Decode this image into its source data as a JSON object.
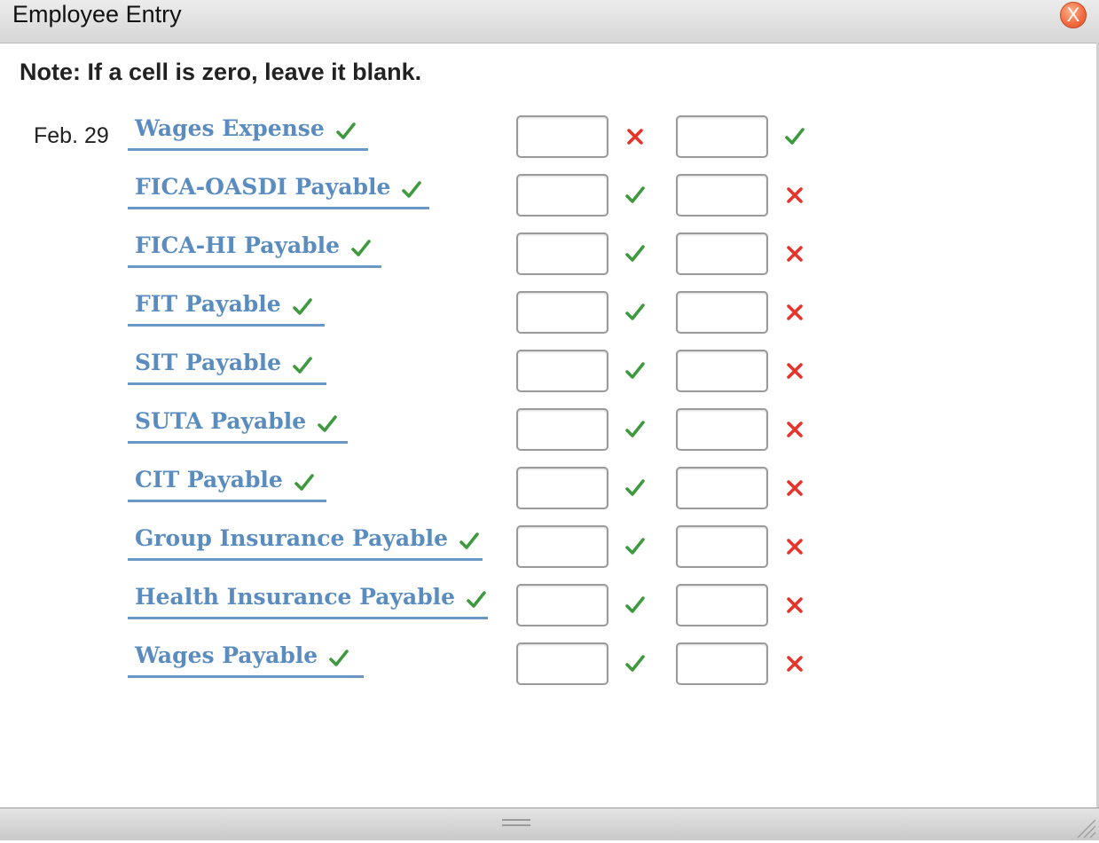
{
  "window": {
    "title": "Employee Entry",
    "close_label": "X"
  },
  "note": "Note: If a cell is zero, leave it blank.",
  "entry": {
    "date": "Feb. 29",
    "rows": [
      {
        "account": "Wages Expense",
        "account_status": "correct",
        "debit": "",
        "debit_status": "incorrect",
        "credit": "",
        "credit_status": "correct"
      },
      {
        "account": "FICA-OASDI Payable",
        "account_status": "correct",
        "debit": "",
        "debit_status": "correct",
        "credit": "",
        "credit_status": "incorrect"
      },
      {
        "account": "FICA-HI Payable",
        "account_status": "correct",
        "debit": "",
        "debit_status": "correct",
        "credit": "",
        "credit_status": "incorrect"
      },
      {
        "account": "FIT Payable",
        "account_status": "correct",
        "debit": "",
        "debit_status": "correct",
        "credit": "",
        "credit_status": "incorrect"
      },
      {
        "account": "SIT Payable",
        "account_status": "correct",
        "debit": "",
        "debit_status": "correct",
        "credit": "",
        "credit_status": "incorrect"
      },
      {
        "account": "SUTA Payable",
        "account_status": "correct",
        "debit": "",
        "debit_status": "correct",
        "credit": "",
        "credit_status": "incorrect"
      },
      {
        "account": "CIT Payable",
        "account_status": "correct",
        "debit": "",
        "debit_status": "correct",
        "credit": "",
        "credit_status": "incorrect"
      },
      {
        "account": "Group Insurance Payable",
        "account_status": "correct",
        "debit": "",
        "debit_status": "correct",
        "credit": "",
        "credit_status": "incorrect"
      },
      {
        "account": "Health Insurance Payable",
        "account_status": "correct",
        "debit": "",
        "debit_status": "correct",
        "credit": "",
        "credit_status": "incorrect"
      },
      {
        "account": "Wages Payable",
        "account_status": "correct",
        "debit": "",
        "debit_status": "correct",
        "credit": "",
        "credit_status": "incorrect"
      }
    ]
  },
  "colors": {
    "account_text": "#5a8cbf",
    "account_underline": "#6b97c4",
    "correct": "#3f9a3f",
    "incorrect": "#e8332a"
  }
}
